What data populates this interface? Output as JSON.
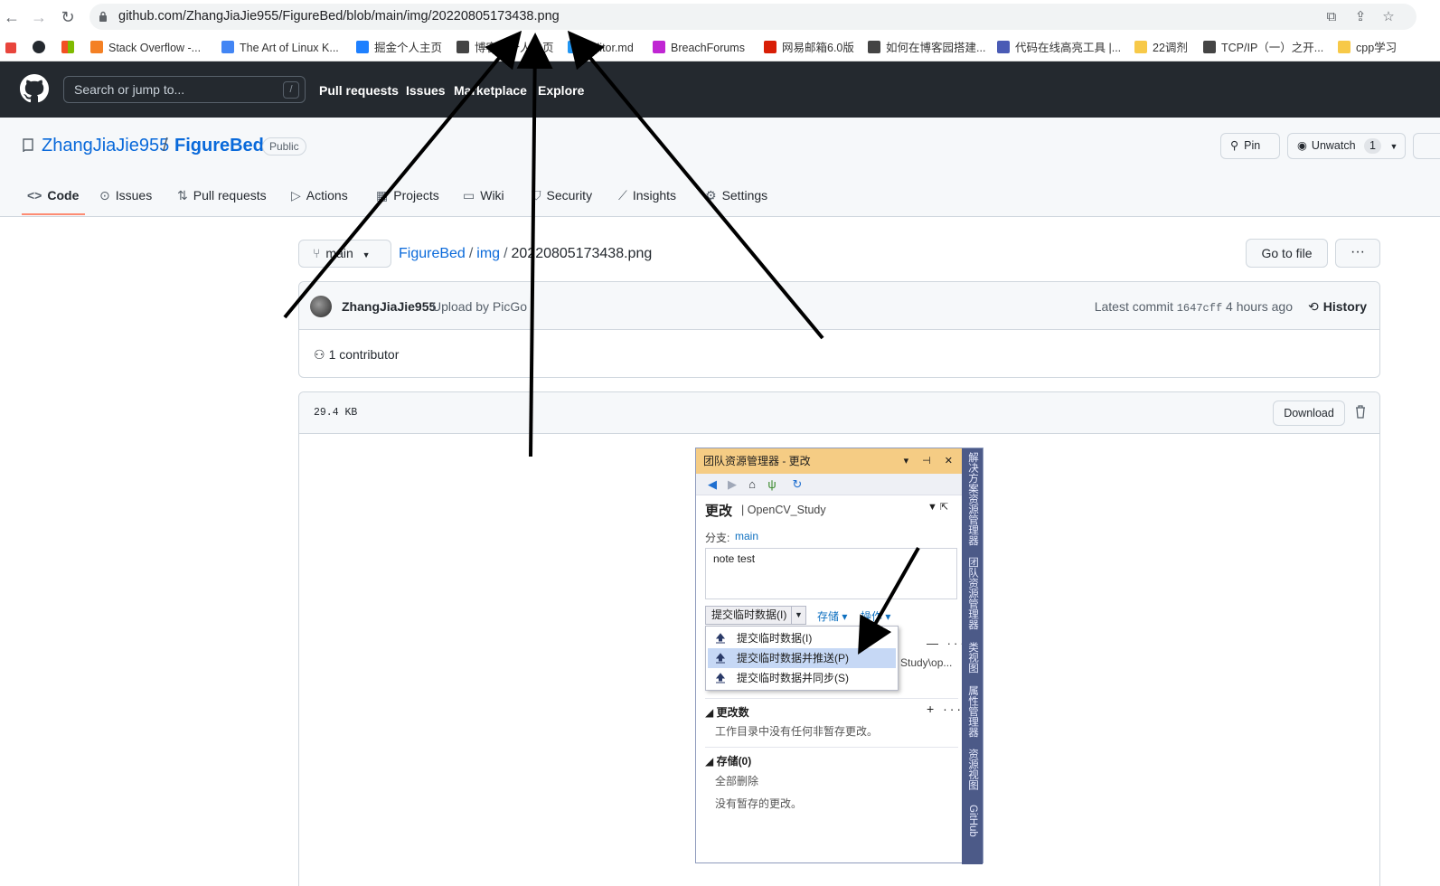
{
  "browser": {
    "url": "github.com/ZhangJiaJie955/FigureBed/blob/main/img/20220805173438.png",
    "bookmarks": [
      {
        "label": "Stack Overflow -...",
        "icon": "stackoverflow-icon",
        "color": "#f48024"
      },
      {
        "label": "The Art of Linux K...",
        "icon": "google-icon",
        "color": "#4285f4"
      },
      {
        "label": "掘金个人主页",
        "icon": "juejin-icon",
        "color": "#1e80ff"
      },
      {
        "label": "博客园个人主页",
        "icon": "cnblogs-icon",
        "color": "#444444"
      },
      {
        "label": "Editor.md",
        "icon": "editormd-icon",
        "color": "#2196f3"
      },
      {
        "label": "BreachForums",
        "icon": "bf-icon",
        "color": "#c026d3"
      },
      {
        "label": "网易邮箱6.0版",
        "icon": "netease-icon",
        "color": "#d81e06"
      },
      {
        "label": "如何在博客园搭建...",
        "icon": "cnblogs-icon",
        "color": "#444444"
      },
      {
        "label": "代码在线高亮工具 |...",
        "icon": "chrome-icon",
        "color": "#4a5bb5"
      },
      {
        "label": "22调剂",
        "icon": "folder-icon",
        "color": "#f7c948"
      },
      {
        "label": "TCP/IP（一）之开...",
        "icon": "cnblogs-icon",
        "color": "#444444"
      },
      {
        "label": "cpp学习",
        "icon": "folder-icon",
        "color": "#f7c948"
      }
    ]
  },
  "gh": {
    "search_placeholder": "Search or jump to...",
    "slash": "/",
    "nav": [
      "Pull requests",
      "Issues",
      "Marketplace",
      "Explore"
    ]
  },
  "repo": {
    "owner": "ZhangJiaJie955",
    "sep": "/",
    "name": "FigureBed",
    "visibility": "Public",
    "pin": "Pin",
    "unwatch": "Unwatch",
    "watch_count": "1",
    "tabs": [
      {
        "label": "Code",
        "icon": "code-icon"
      },
      {
        "label": "Issues",
        "icon": "issue-icon"
      },
      {
        "label": "Pull requests",
        "icon": "pr-icon"
      },
      {
        "label": "Actions",
        "icon": "play-icon"
      },
      {
        "label": "Projects",
        "icon": "table-icon"
      },
      {
        "label": "Wiki",
        "icon": "book-icon"
      },
      {
        "label": "Security",
        "icon": "shield-icon"
      },
      {
        "label": "Insights",
        "icon": "graph-icon"
      },
      {
        "label": "Settings",
        "icon": "gear-icon"
      }
    ]
  },
  "file": {
    "branch": "main",
    "crumb_repo": "FigureBed",
    "crumb_dir": "img",
    "crumb_file": "20220805173438.png",
    "goto": "Go to file",
    "more": "···",
    "author": "ZhangJiaJie955",
    "message": "Upload by PicGo",
    "latest": "Latest commit",
    "sha": "1647cff",
    "age": "4 hours ago",
    "history": "History",
    "contributors": "1 contributor",
    "size": "29.4 KB",
    "download": "Download"
  },
  "vs": {
    "title": "团队资源管理器 - 更改",
    "title_ctl": "▾ ⊣ ✕",
    "heading": "更改",
    "project": "OpenCV_Study",
    "branch_label": "分支:",
    "branch": "main",
    "message": "note test",
    "commit_btn": "提交临时数据(I)",
    "stash": "存储 ▾",
    "actions": "操作 ▾",
    "menu": [
      "提交临时数据(I)",
      "提交临时数据并推送(P)",
      "提交临时数据并同步(S)"
    ],
    "behind_text": "Study\\op...",
    "sec_changes": "更改数",
    "changes_text": "工作目录中没有任何非暂存更改。",
    "sec_stashes": "存储(0)",
    "delete_all": "全部删除",
    "no_stash_text": "没有暂存的更改。",
    "side_tabs": [
      "解决方案资源管理器",
      "团队资源管理器",
      "类视图",
      "属性管理器",
      "资源视图",
      "GitHub"
    ]
  }
}
